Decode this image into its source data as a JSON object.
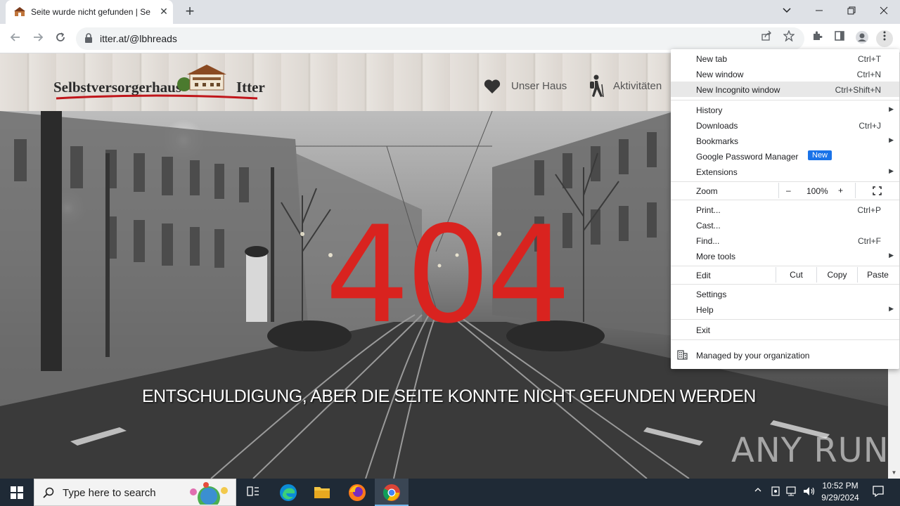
{
  "browser": {
    "tab_title": "Seite wurde nicht gefunden | Sel",
    "url": "itter.at/@lbhreads",
    "close_tab_glyph": "✕",
    "new_tab_glyph": "+"
  },
  "site": {
    "logo_left": "Selbstversorgerhaus",
    "logo_right": "Itter",
    "nav": [
      {
        "label": "Unser Haus",
        "icon": "heart-icon"
      },
      {
        "label": "Aktivitäten",
        "icon": "hiker-icon"
      }
    ],
    "error_code": "404",
    "error_message": "ENTSCHULDIGUNG, ABER DIE SEITE KONNTE NICHT GEFUNDEN WERDEN",
    "watermark": "ANY RUN"
  },
  "menu": {
    "items": [
      {
        "label": "New tab",
        "shortcut": "Ctrl+T"
      },
      {
        "label": "New window",
        "shortcut": "Ctrl+N"
      },
      {
        "label": "New Incognito window",
        "shortcut": "Ctrl+Shift+N"
      },
      {
        "label": "History",
        "shortcut": ""
      },
      {
        "label": "Downloads",
        "shortcut": "Ctrl+J"
      },
      {
        "label": "Bookmarks",
        "shortcut": ""
      },
      {
        "label": "Google Password Manager",
        "shortcut": "",
        "badge": "New"
      },
      {
        "label": "Extensions",
        "shortcut": ""
      },
      {
        "label": "Zoom",
        "zoom_minus": "–",
        "zoom_value": "100%",
        "zoom_plus": "+"
      },
      {
        "label": "Print...",
        "shortcut": "Ctrl+P"
      },
      {
        "label": "Cast...",
        "shortcut": ""
      },
      {
        "label": "Find...",
        "shortcut": "Ctrl+F"
      },
      {
        "label": "More tools",
        "shortcut": ""
      },
      {
        "label": "Edit",
        "cut": "Cut",
        "copy": "Copy",
        "paste": "Paste"
      },
      {
        "label": "Settings",
        "shortcut": ""
      },
      {
        "label": "Help",
        "shortcut": ""
      },
      {
        "label": "Exit",
        "shortcut": ""
      },
      {
        "label": "Managed by your organization",
        "shortcut": ""
      }
    ]
  },
  "taskbar": {
    "search_placeholder": "Type here to search",
    "time": "10:52 PM",
    "date": "9/29/2024"
  },
  "colors": {
    "error_red": "#d9231f",
    "incognito_highlight": "#e8e8e8",
    "badge_blue": "#1a73e8",
    "taskbar": "#1f2a36"
  }
}
